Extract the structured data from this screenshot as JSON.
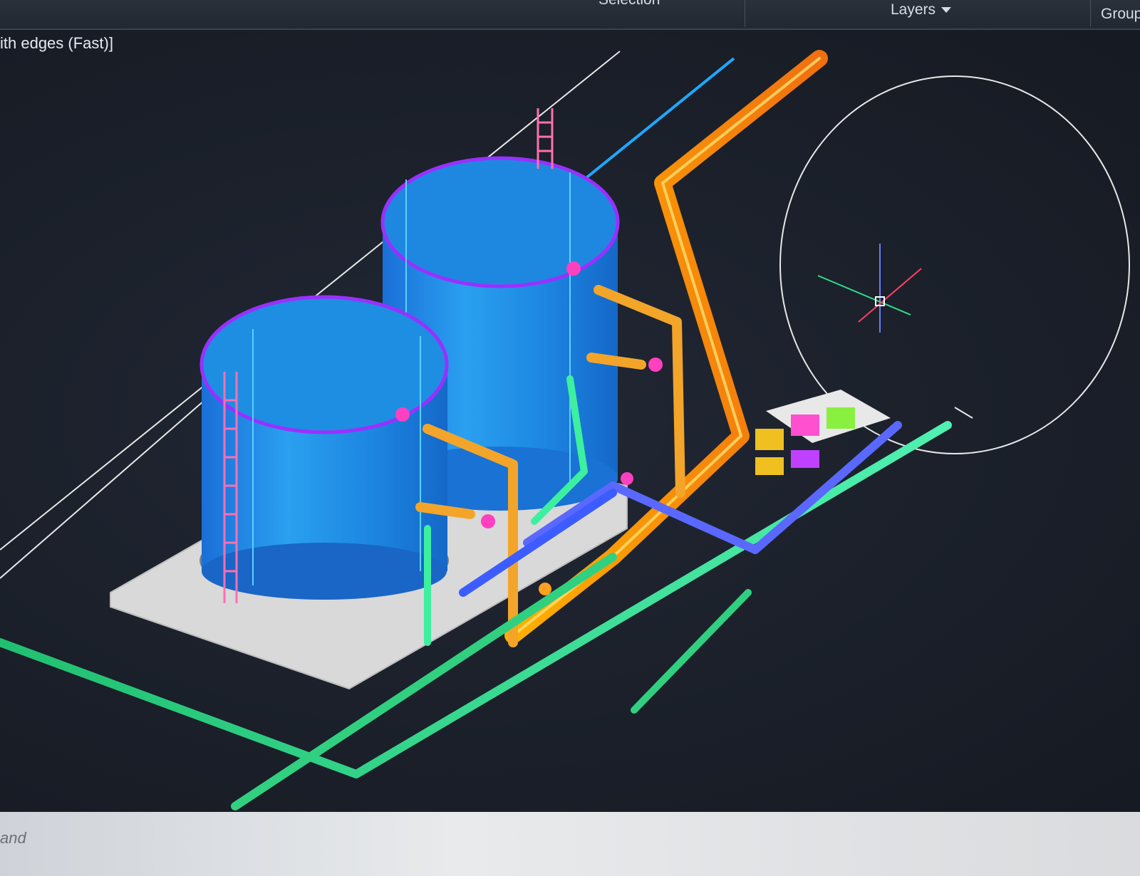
{
  "ribbon": {
    "panels": [
      {
        "label": "Selection"
      },
      {
        "label": "Layers",
        "has_dropdown": true
      },
      {
        "label": "Group"
      }
    ]
  },
  "viewport": {
    "label": "ith edges (Fast)]"
  },
  "command_line": {
    "placeholder": "and"
  },
  "colors": {
    "tank": "#1e8fe0",
    "tank_rim": "#8a2be2",
    "ladder": "#ff6fb0",
    "pipe_yellow": "#f0a020",
    "pipe_green": "#2ee08a",
    "pipe_blue": "#5060ff",
    "background": "#1a1f29"
  },
  "icons": [
    "dropdown-arrow-icon",
    "ucs-crosshair-icon",
    "navigation-circle-icon"
  ]
}
